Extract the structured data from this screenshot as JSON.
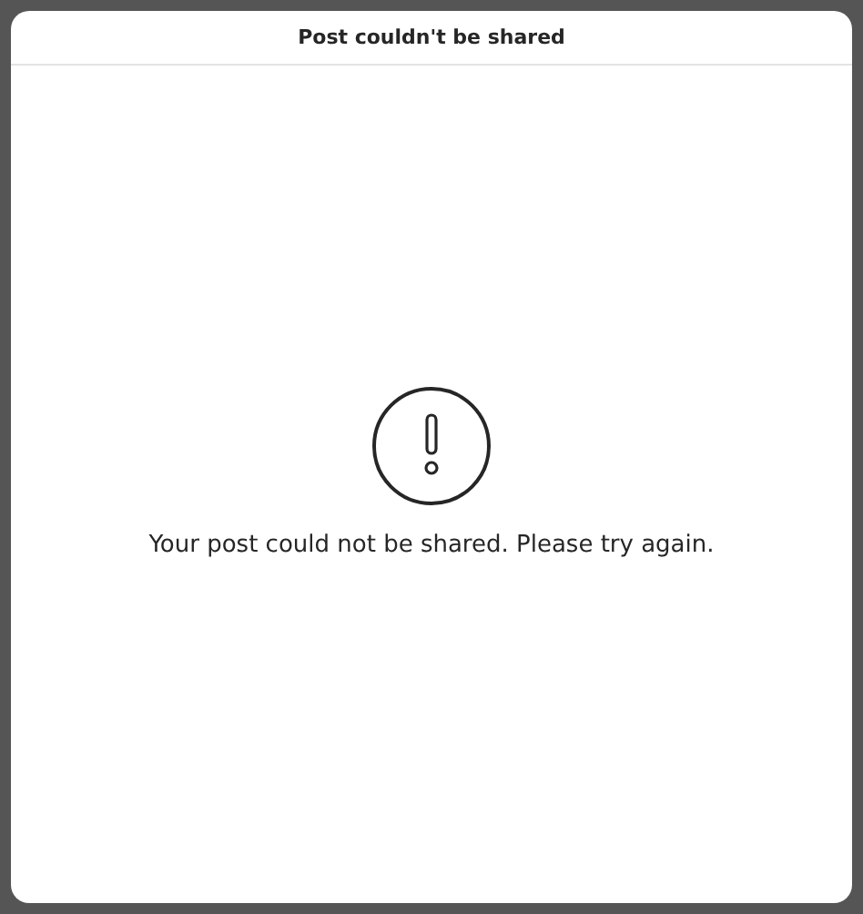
{
  "dialog": {
    "title": "Post couldn't be shared",
    "message": "Your post could not be shared. Please try again."
  }
}
